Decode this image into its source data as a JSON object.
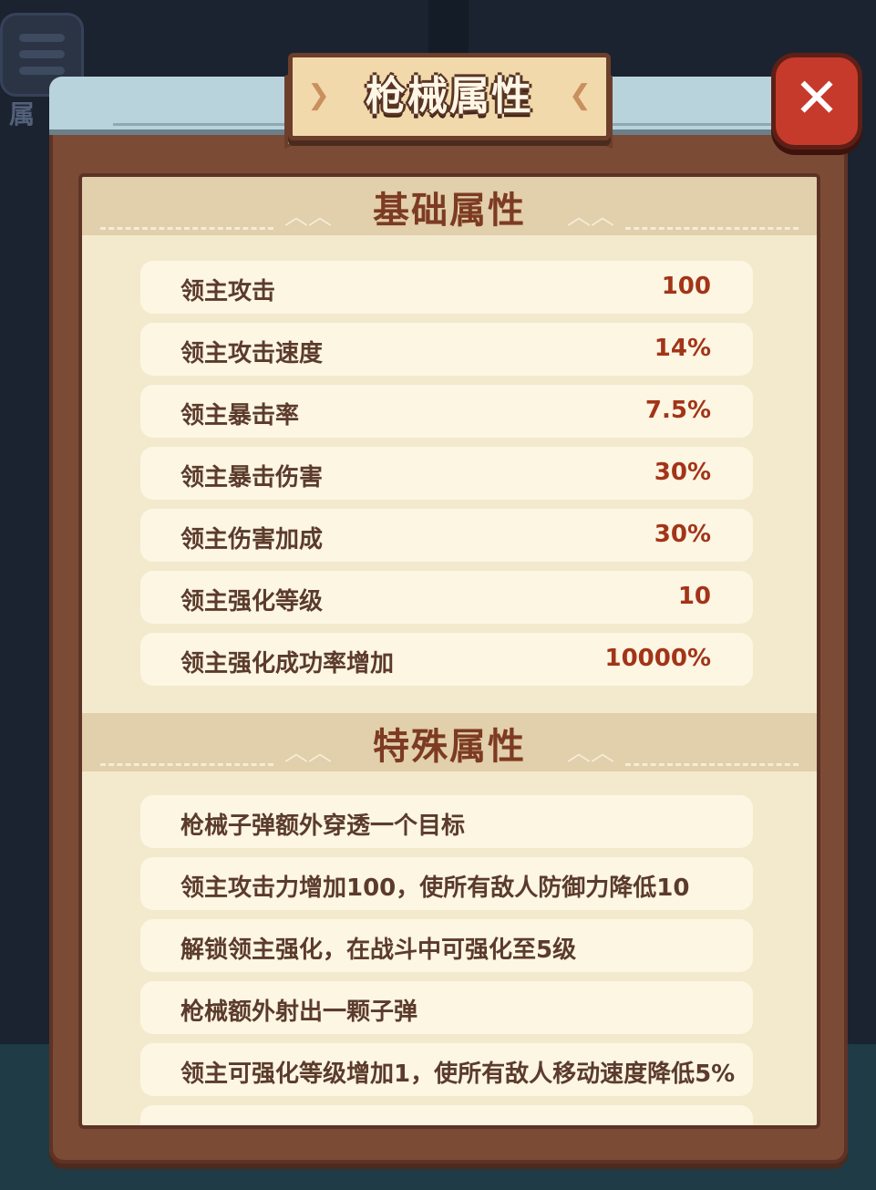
{
  "background": {
    "menu_label": "属"
  },
  "dialog": {
    "title": "枪械属性",
    "close_label": "✕"
  },
  "basic": {
    "heading": "基础属性",
    "rows": [
      {
        "name": "领主攻击",
        "value": "100"
      },
      {
        "name": "领主攻击速度",
        "value": "14%"
      },
      {
        "name": "领主暴击率",
        "value": "7.5%"
      },
      {
        "name": "领主暴击伤害",
        "value": "30%"
      },
      {
        "name": "领主伤害加成",
        "value": "30%"
      },
      {
        "name": "领主强化等级",
        "value": "10"
      },
      {
        "name": "领主强化成功率增加",
        "value": "10000%"
      }
    ]
  },
  "special": {
    "heading": "特殊属性",
    "rows": [
      "枪械子弹额外穿透一个目标",
      "领主攻击力增加100，使所有敌人防御力降低10",
      "解锁领主强化，在战斗中可强化至5级",
      "枪械额外射出一颗子弹",
      "领主可强化等级增加1，使所有敌人移动速度降低5%"
    ]
  },
  "colors": {
    "frame": "#7c4b36",
    "panel": "#f3eace",
    "section_heading": "#7c3b22",
    "value_text": "#a33418",
    "close_button": "#c63a2c"
  },
  "icons": {
    "close": "close-icon",
    "menu": "menu-icon"
  }
}
